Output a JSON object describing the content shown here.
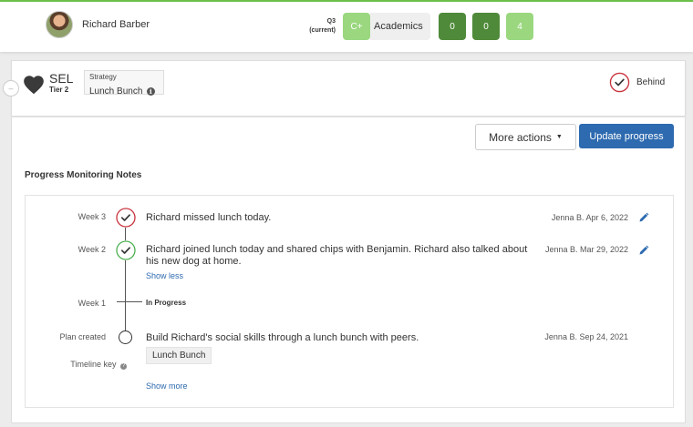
{
  "student": {
    "name": "Richard Barber"
  },
  "term": {
    "label": "Q3",
    "sub": "(current)"
  },
  "grades": {
    "grade": "C+",
    "subject": "Academics",
    "counts": [
      "0",
      "0",
      "4"
    ]
  },
  "card": {
    "domain": "SEL",
    "tier": "Tier 2",
    "strategy_label": "Strategy",
    "strategy_value": "Lunch Bunch",
    "status": "Behind"
  },
  "actions": {
    "more_actions": "More actions",
    "update_progress": "Update progress"
  },
  "notes": {
    "title": "Progress Monitoring Notes",
    "entries": [
      {
        "week": "Week 3",
        "text": "Richard missed lunch today.",
        "meta": "Jenna B. Apr 6, 2022"
      },
      {
        "week": "Week 2",
        "text": "Richard joined lunch today and shared chips with Benjamin. Richard also talked about his new dog at home.",
        "meta": "Jenna B. Mar 29, 2022",
        "link": "Show less"
      },
      {
        "week": "Week 1",
        "status": "In Progress"
      },
      {
        "week": "Plan created",
        "text": "Build Richard's social skills through a lunch bunch with peers.",
        "meta": "Jenna B. Sep 24, 2021",
        "chip": "Lunch Bunch"
      }
    ],
    "timeline_key": "Timeline key",
    "show_more": "Show more"
  },
  "colors": {
    "brand_blue": "#2d6aaf",
    "dark_green": "#4f8a3a",
    "light_green": "#9ad77f",
    "behind_red": "#c8323c",
    "on_track_green": "#4caf50"
  }
}
